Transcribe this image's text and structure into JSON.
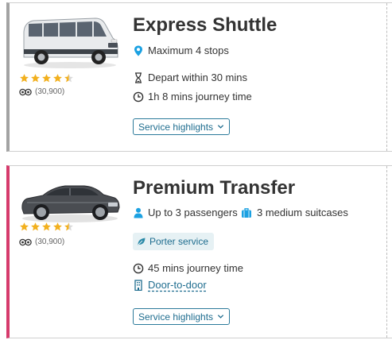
{
  "colors": {
    "accent_link": "#1f6d8f",
    "card1_border": "#a3a3a3",
    "card2_border": "#d63b6c",
    "star": "#f2b01e",
    "pin": "#1ba1e2",
    "person": "#1ba1e2"
  },
  "cards": [
    {
      "title": "Express Shuttle",
      "vehicle_image": "white-minibus",
      "rating_stars": 4.5,
      "review_count": "(30,900)",
      "features": [
        {
          "icon": "map-pin-icon",
          "text": "Maximum 4 stops"
        },
        {
          "icon": "hourglass-icon",
          "text": "Depart within 30 mins"
        },
        {
          "icon": "clock-icon",
          "text": "1h 8 mins journey time"
        }
      ],
      "highlights_label": "Service highlights"
    },
    {
      "title": "Premium Transfer",
      "vehicle_image": "black-sedan",
      "rating_stars": 4.5,
      "review_count": "(30,900)",
      "features": [
        {
          "icon": "person-icon",
          "text": "Up to 3 passengers"
        },
        {
          "icon": "suitcase-icon",
          "text": "3 medium suitcases"
        },
        {
          "icon": "clock-icon",
          "text": "45 mins journey time"
        },
        {
          "icon": "building-icon",
          "text": "Door-to-door"
        }
      ],
      "badge": {
        "icon": "leaf-icon",
        "text": "Porter service"
      },
      "highlights_label": "Service highlights"
    }
  ]
}
